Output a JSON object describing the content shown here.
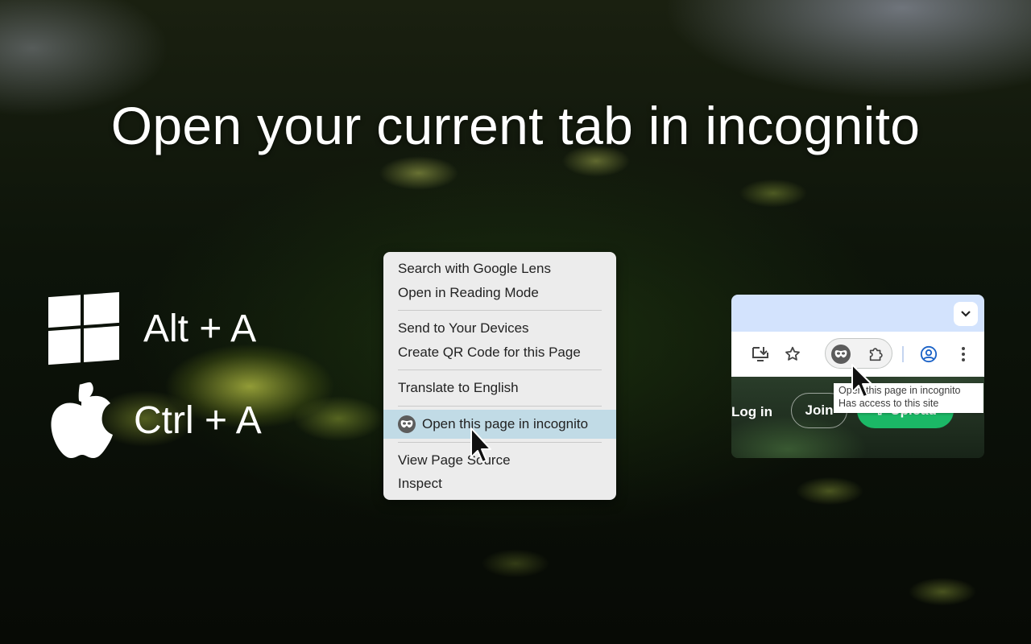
{
  "hero": {
    "title": "Open your current tab in incognito"
  },
  "shortcuts": {
    "windows": {
      "icon": "windows-logo-icon",
      "keys": "Alt + A"
    },
    "mac": {
      "icon": "apple-logo-icon",
      "keys": "Ctrl + A"
    }
  },
  "context_menu": {
    "groups": [
      [
        "Search with Google Lens",
        "Open in Reading Mode"
      ],
      [
        "Send to Your Devices",
        "Create QR Code for this Page"
      ],
      [
        "Translate to English"
      ],
      [
        "Open this page in incognito"
      ],
      [
        "View Page Source",
        "Inspect"
      ]
    ],
    "highlighted_item": "Open this page in incognito",
    "highlight_color": "#c1dbe6"
  },
  "browser": {
    "toolbar_icons": [
      "install-app-icon",
      "bookmark-star-icon",
      "incognito-extension-icon",
      "extensions-puzzle-icon",
      "profile-icon",
      "more-menu-icon"
    ],
    "tab_dropdown_icon": "chevron-down-icon",
    "page": {
      "login": "Log in",
      "join": "Join",
      "upload": "Upload"
    },
    "tooltip": {
      "line1": "Open this page in incognito",
      "line2": "Has access to this site"
    },
    "accent_tabstrip": "#d3e3fd",
    "upload_color": "#1bb866"
  }
}
